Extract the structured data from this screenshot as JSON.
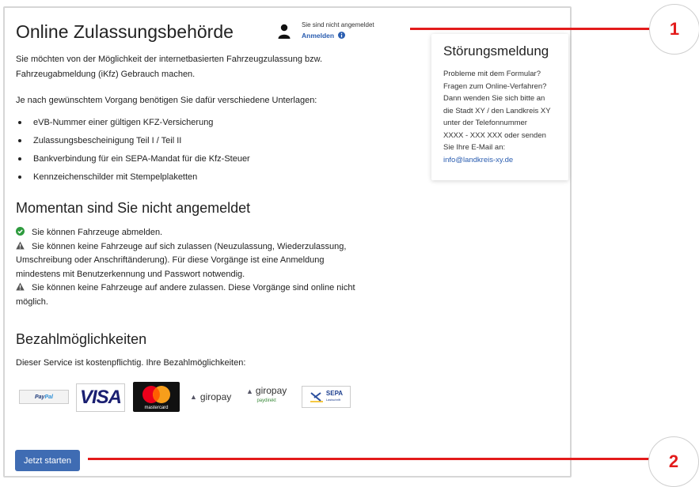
{
  "header": {
    "title": "Online Zulassungsbehörde",
    "status_text": "Sie sind nicht angemeldet",
    "login_link": "Anmelden"
  },
  "intro": {
    "p1_line1": "Sie möchten von der Möglichkeit der internetbasierten Fahrzeugzulassung bzw.",
    "p1_line2": "Fahrzeugabmeldung (iKfz) Gebrauch machen.",
    "p2": "Je nach gewünschtem Vorgang benötigen Sie dafür verschiedene Unterlagen:",
    "documents": [
      "eVB-Nummer einer gültigen KFZ-Versicherung",
      "Zulassungsbescheinigung Teil I / Teil II",
      "Bankverbindung für ein SEPA-Mandat für die Kfz-Steuer",
      "Kennzeichenschilder mit Stempelplaketten"
    ]
  },
  "status_section": {
    "heading": "Momentan sind Sie nicht angemeldet",
    "ok_line": "Sie können Fahrzeuge abmelden.",
    "warn1_line1": "Sie können keine Fahrzeuge auf sich zulassen (Neuzulassung, Wiederzulassung,",
    "warn1_line2": "Umschreibung oder Anschriftänderung). Für diese Vorgänge ist eine Anmeldung",
    "warn1_line3": "mindestens mit Benutzerkennung und Passwort notwendig.",
    "warn2_line1": "Sie können keine Fahrzeuge auf andere zulassen. Diese Vorgänge sind online nicht",
    "warn2_line2": "möglich."
  },
  "payment": {
    "heading": "Bezahlmöglichkeiten",
    "text": "Dieser Service ist kostenpflichtig. Ihre Bezahlmöglichkeiten:",
    "methods": {
      "paypal_pre": "Pay",
      "paypal_post": "Pal",
      "visa": "VISA",
      "mastercard": "mastercard",
      "giropay": "giropay",
      "giropay_paydirekt_top": "giropay",
      "giropay_paydirekt_sub": "paydirekt",
      "sepa": "SEPA",
      "sepa_sub": "Lastschrift"
    }
  },
  "actions": {
    "start_label": "Jetzt starten"
  },
  "sidebar": {
    "title": "Störungsmeldung",
    "line1": "Probleme mit dem Formular?",
    "line2": "Fragen zum Online-Verfahren?",
    "line3": "Dann wenden Sie sich bitte an",
    "line4": "die Stadt XY / den Landkreis XY",
    "line5": "unter der Telefonnummer",
    "line6": "XXXX - XXX XXX oder senden",
    "line7": "Sie Ihre E-Mail an:",
    "email": "info@landkreis-xy.de"
  },
  "annotations": {
    "marker1": "1",
    "marker2": "2"
  },
  "colors": {
    "accent_blue": "#3f6cb3",
    "link_blue": "#2a5db0",
    "annotation_red": "#e31b1b",
    "ok_green": "#2e9b3e",
    "warn_gray": "#555555"
  }
}
